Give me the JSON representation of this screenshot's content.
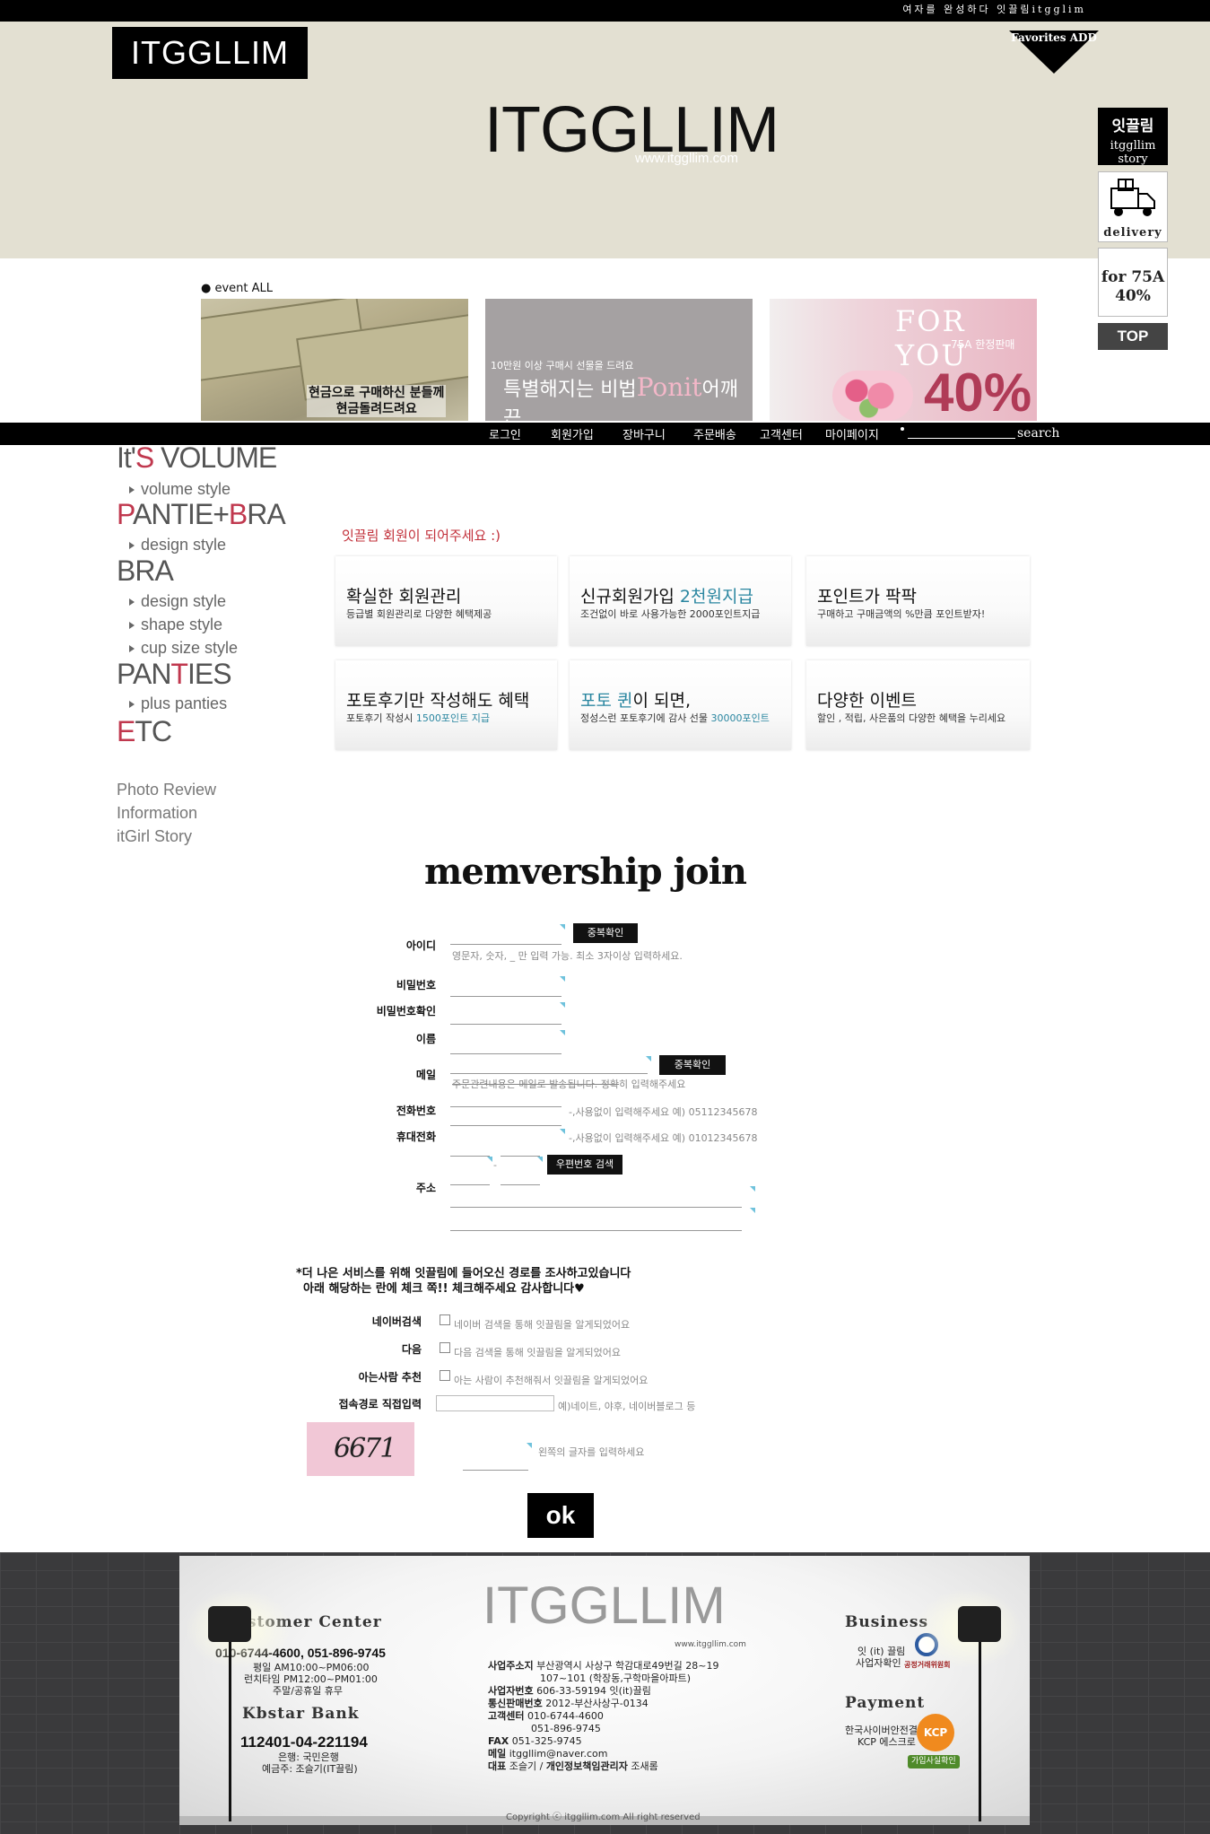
{
  "topbar": {
    "slogan": "여자를 완성하다 잇끌림itgglim"
  },
  "header": {
    "logo_box": "ITGGLLIM",
    "favorites": "Favorites ADD",
    "main_logo": "ITGGLLIM",
    "main_url": "www.itggllim.com"
  },
  "quick": {
    "story_ko": "잇끌림",
    "story_en": "itggllim story",
    "delivery": "delivery",
    "promo_line1": "for 75A",
    "promo_line2": "40%",
    "top": "TOP"
  },
  "events": {
    "label": "● event ALL",
    "banner1_line1": "현금으로 구매하신 분들께",
    "banner1_line2": "현금돌려드려요",
    "banner2_line1": "10만원 이상 구매시 선물을 드려요",
    "banner2_pre": "특별해지는 비법",
    "banner2_mid": "Ponit",
    "banner2_post": "어깨끈",
    "banner3_title": "FOR YOU",
    "banner3_sub": "75A 한정판매",
    "banner3_pct": "40%"
  },
  "nav": {
    "items": [
      "로그인",
      "회원가입",
      "장바구니",
      "주문배송",
      "고객센터",
      "마이페이지"
    ],
    "search": "search"
  },
  "sidebar": {
    "cat1_pre": "It'",
    "cat1_red": "S",
    "cat1_post": " VOLUME",
    "sub_volume": "volume style",
    "cat2_red1": "P",
    "cat2_mid": "ANTIE+",
    "cat2_red2": "B",
    "cat2_post": "RA",
    "sub_design1": "design style",
    "cat3": "BRA",
    "sub_design2": "design style",
    "sub_shape": "shape style",
    "sub_cup": "cup size style",
    "cat4_pre": "PAN",
    "cat4_red": "T",
    "cat4_post": "IES",
    "sub_plus": "plus panties",
    "cat5_red": "E",
    "cat5_post": "TC",
    "link_photo": "Photo Review",
    "link_info": "Information",
    "link_story": "itGirl Story"
  },
  "benefits": {
    "intro": "잇끌림 회원이 되어주세요 :)",
    "b1_h": "확실한 회원관리",
    "b1_d": "등급별 회원관리로 다양한 혜택제공",
    "b2_h": "신규회원가입 ",
    "b2_h_blue": "2천원지급",
    "b2_d": "조건없이 바로 사용가능한 2000포인트지급",
    "b3_h": "포인트가 팍팍",
    "b3_d": "구매하고 구매금액의 %만큼 포인트받자!",
    "b4_h": "포토후기만 작성해도 혜택",
    "b4_d_pre": "포토후기 작성시 ",
    "b4_d_blue": "1500포인트 지급",
    "b5_h_blue": "포토 퀸",
    "b5_h": "이 되면,",
    "b5_d_pre": "정성스런 포토후기에 감사 선물 ",
    "b5_d_blue": "30000포인트",
    "b6_h": "다양한 이벤트",
    "b6_d": "할인 , 적립, 사은품의 다양한 혜택을 누리세요"
  },
  "form": {
    "title": "memvership join",
    "id_label": "아이디",
    "dup_check": "중복확인",
    "id_hint": "영문자, 숫자, _ 만 입력 가능. 최소 3자이상 입력하세요.",
    "pw_label": "비밀번호",
    "pw_confirm_label": "비밀번호확인",
    "name_label": "이름",
    "email_label": "메일",
    "email_dup_check": "중복확인",
    "email_hint_strike": "주문관련내용은 메일로 발송됩니다. 정확",
    "email_hint": "히 입력해주세요",
    "phone_label": "전화번호",
    "phone_hint": "-,사용없이 입력해주세요 예) 05112345678",
    "mobile_label": "휴대전화",
    "mobile_hint": "-,사용없이 입력해주세요 예) 01012345678",
    "zip_dash": "-",
    "zip_search": "우편번호 검색",
    "address_label": "주소"
  },
  "survey": {
    "intro_line1": "*더 나은 서비스를 위해 잇끌림에 들어오신 경로를 조사하고있습니다",
    "intro_line2": "아래 해당하는 란에 체크 쪽!! 체크해주세요 감사합니다♥",
    "naver_label": "네이버검색",
    "naver_text": "네이버 검색을 통해 잇끌림을 알게되었어요",
    "daum_label": "다음",
    "daum_text": "다음 검색을 통해 잇끌림을 알게되었어요",
    "friend_label": "아는사람 추천",
    "friend_text": "아는 사람이 추천해줘서 잇끌림을 알게되었어요",
    "direct_label": "접속경로 직접입력",
    "direct_hint": "예)네이트, 야후, 네이버블로그 등",
    "captcha_text": "6671",
    "captcha_hint": "왼쪽의 글자를 입력하세요",
    "ok": "ok"
  },
  "footer": {
    "cc_title": "Customer Center",
    "cc_phones": "010-6744-4600, 051-896-9745",
    "cc_hours1": "평일 AM10:00~PM06:00",
    "cc_hours2": "런치타임 PM12:00~PM01:00",
    "cc_hours3": "주말/공휴일 휴무",
    "bank_title": "Kbstar Bank",
    "bank_no": "112401-04-221194",
    "bank_name": "은행: 국민은행",
    "bank_holder": "예금주: 조슬기(IT끌림)",
    "logo": "ITGGLLIM",
    "url": "www.itggllim.com",
    "addr_label": "사업주소지",
    "addr1": "부산광역시 사상구 학감대로49번길 28~19",
    "addr2": "107~101 (학장동,구학마을아파트)",
    "bizno_label": "사업자번호",
    "bizno": "606-33-59194 잇(it)끌림",
    "mail_order_label": "통신판매번호",
    "mail_order": "2012-부산사상구-0134",
    "cs_label": "고객센터",
    "cs1": "010-6744-4600",
    "cs2": "051-896-9745",
    "fax_label": "FAX",
    "fax": "051-325-9745",
    "email_label": "메일",
    "email": "itggllim@naver.com",
    "rep_label": "대표",
    "rep": "조슬기 / ",
    "rep_privacy_label": "개인정보책임관리자",
    "rep_privacy": " 조새롬",
    "business_title": "Business",
    "business_text1": "잇 (it) 끌림",
    "business_text2": "사업자확인",
    "ftc": "공정거래위원회",
    "payment_title": "Payment",
    "payment_text1": "한국사이버안전결제",
    "payment_text2": "KCP 에스크로",
    "kcp": "KCP",
    "kcp_confirm": "가입사실확인",
    "copyright": "Copyright ⓒ itggllim.com All right reserved"
  }
}
